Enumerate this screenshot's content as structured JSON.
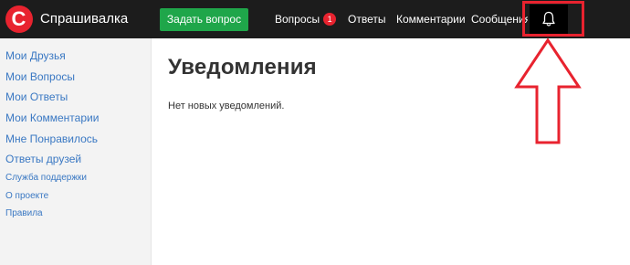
{
  "header": {
    "logo_letter": "С",
    "brand": "Спрашивалка",
    "ask_button": "Задать вопрос",
    "nav": {
      "questions": "Вопросы",
      "questions_badge": "1",
      "answers": "Ответы",
      "comments": "Комментарии",
      "messages": "Сообщения"
    },
    "icons": {
      "bell": "bell-icon"
    }
  },
  "sidebar": {
    "items": [
      "Мои Друзья",
      "Мои Вопросы",
      "Мои Ответы",
      "Мои Комментарии",
      "Мне Понравилось",
      "Ответы друзей"
    ],
    "links": [
      "Служба поддержки",
      "О проекте",
      "Правила"
    ]
  },
  "main": {
    "title": "Уведомления",
    "empty_text": "Нет новых уведомлений."
  },
  "colors": {
    "header_bg": "#1c1c1c",
    "brand_red": "#e8232f",
    "ask_green": "#1fa64a",
    "link_blue": "#3a78c3",
    "sidebar_bg": "#f3f3f3"
  }
}
